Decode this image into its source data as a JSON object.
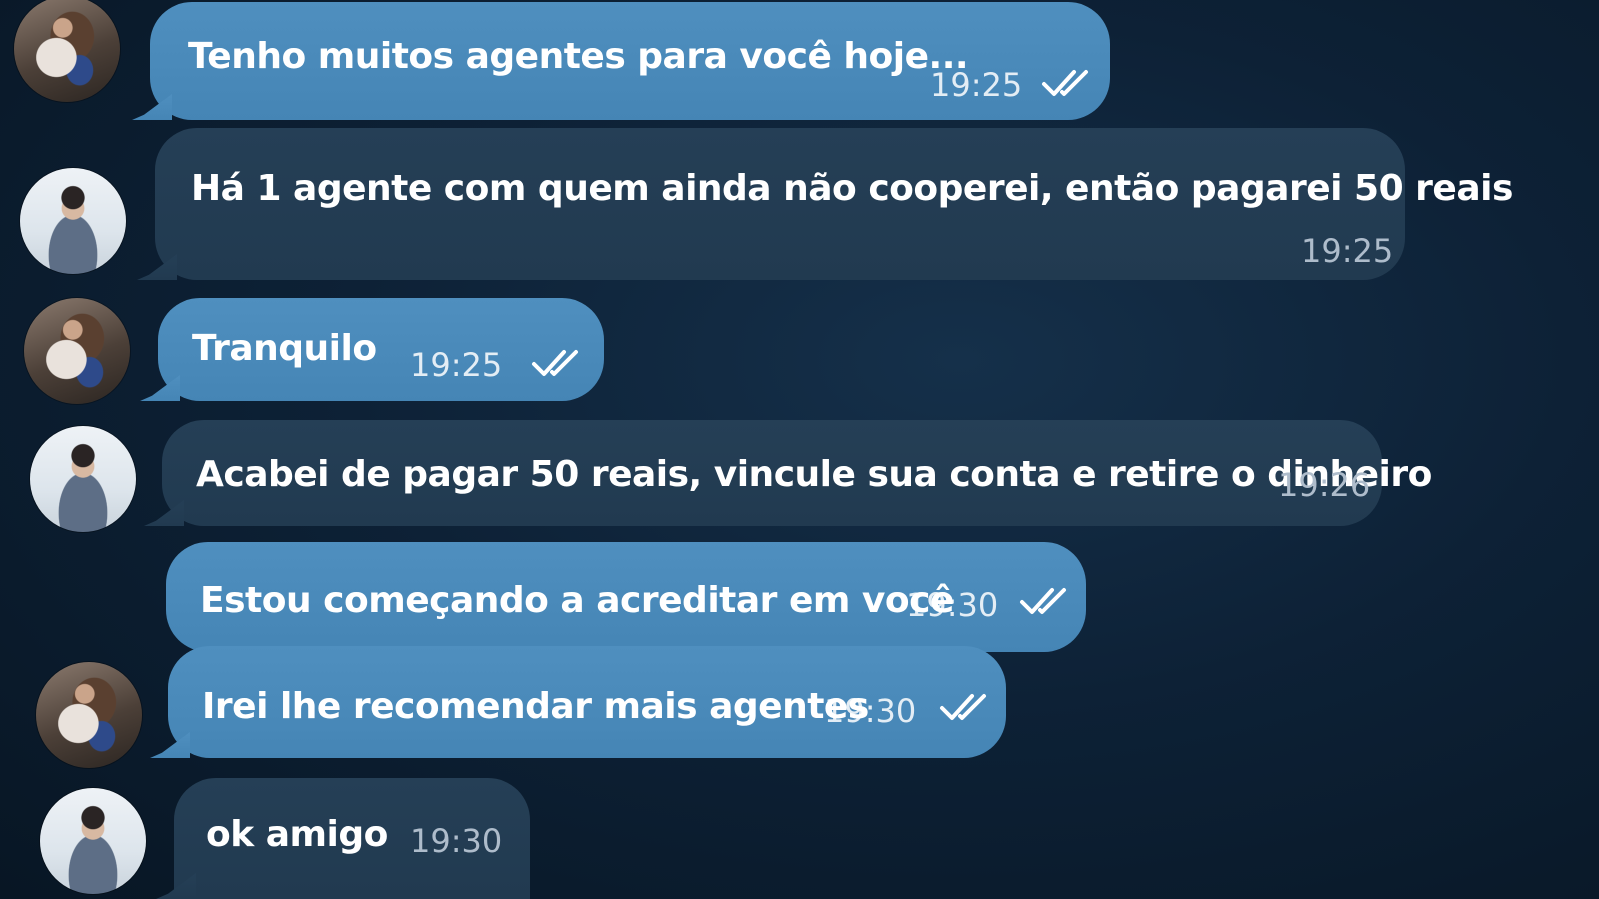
{
  "colors": {
    "outgoing_bubble": "#4a8aba",
    "incoming_bubble": "#233d54",
    "background": "#0d2136",
    "check_color": "#ffffff"
  },
  "messages": [
    {
      "direction": "out",
      "avatar": "woman-avatar",
      "text": "Tenho muitos agentes para você hoje...",
      "time": "19:25",
      "read_receipt": "double-check-icon"
    },
    {
      "direction": "in",
      "avatar": "man-avatar",
      "text": "Há 1 agente com quem ainda não cooperei, então pagarei 50 reais",
      "time": "19:25"
    },
    {
      "direction": "out",
      "avatar": "woman-avatar",
      "text": "Tranquilo",
      "time": "19:25",
      "read_receipt": "double-check-icon"
    },
    {
      "direction": "in",
      "avatar": "man-avatar",
      "text": "Acabei de pagar 50 reais, vincule sua conta e retire o dinheiro",
      "time": "19:26"
    },
    {
      "direction": "out",
      "avatar": null,
      "text": "Estou começando a acreditar em você",
      "time": "19:30",
      "read_receipt": "double-check-icon"
    },
    {
      "direction": "out",
      "avatar": "woman-avatar",
      "text": "Irei lhe recomendar mais agentes",
      "time": "19:30",
      "read_receipt": "double-check-icon"
    },
    {
      "direction": "in",
      "avatar": "man-avatar",
      "text": "ok amigo",
      "time": "19:30"
    }
  ]
}
